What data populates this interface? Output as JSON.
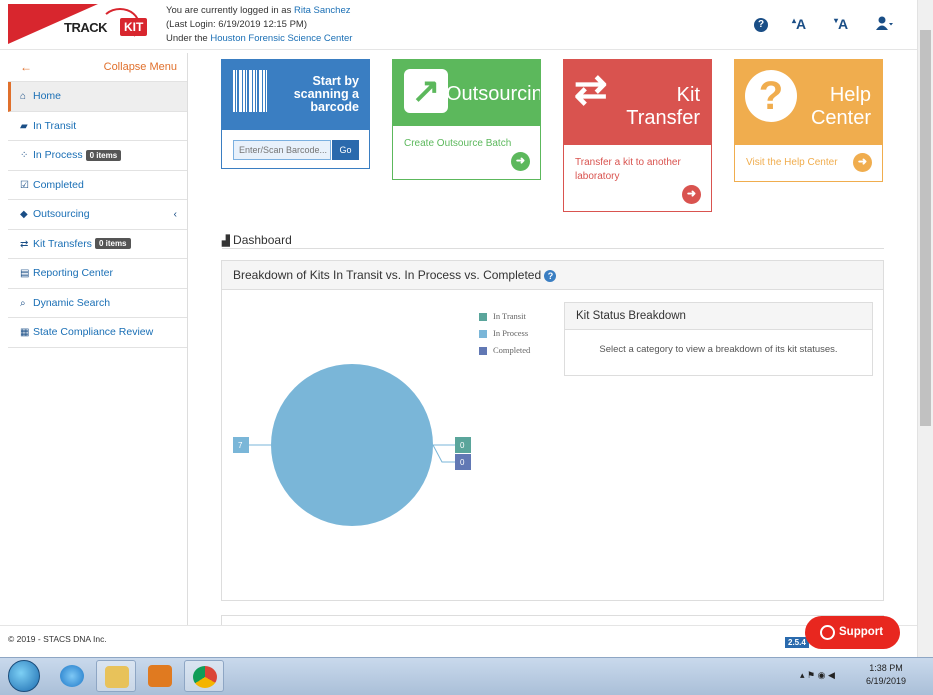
{
  "header": {
    "logo_track": "TRACK",
    "logo_kit": "KIT",
    "login_prefix": "You are currently logged in as ",
    "user_name": "Rita Sanchez",
    "last_login": "(Last Login: 6/19/2019 12:15 PM)",
    "org_prefix": "Under the ",
    "org_name": "Houston Forensic Science Center",
    "icons": [
      "question-circle-icon",
      "font-increase-icon",
      "font-decrease-icon",
      "user-menu-icon"
    ]
  },
  "sidebar": {
    "collapse_label": "Collapse Menu",
    "items": [
      {
        "label": "Home",
        "icon": "home-icon",
        "active": true
      },
      {
        "label": "In Transit",
        "icon": "truck-icon"
      },
      {
        "label": "In Process",
        "icon": "spinner-icon",
        "badge": "0 items"
      },
      {
        "label": "Completed",
        "icon": "check-square-icon"
      },
      {
        "label": "Outsourcing",
        "icon": "tags-icon",
        "chevron": true
      },
      {
        "label": "Kit Transfers",
        "icon": "exchange-icon",
        "badge": "0 items"
      },
      {
        "label": "Reporting Center",
        "icon": "file-icon"
      },
      {
        "label": "Dynamic Search",
        "icon": "search-icon"
      },
      {
        "label": "State Compliance Review",
        "icon": "calendar-check-icon"
      }
    ]
  },
  "tiles": {
    "scan": {
      "title": "Start by scanning a barcode",
      "placeholder": "Enter/Scan Barcode...",
      "go_label": "Go",
      "color": "#3a7ec2"
    },
    "outsourcing": {
      "title": "Outsourcing",
      "link": "Create Outsource Batch",
      "color": "#5cb85c"
    },
    "kit_transfer": {
      "title_line1": "Kit",
      "title_line2": "Transfer",
      "link": "Transfer a kit to another laboratory",
      "color": "#d9534f"
    },
    "help": {
      "title_line1": "Help",
      "title_line2": "Center",
      "link": "Visit the Help Center",
      "color": "#f0ad4e"
    }
  },
  "dashboard": {
    "title": "Dashboard",
    "panel_title": "Breakdown of Kits In Transit vs. In Process vs. Completed",
    "status_title": "Kit Status Breakdown",
    "status_body": "Select a category to view a breakdown of its kit statuses."
  },
  "chart_data": {
    "type": "pie",
    "categories": [
      "In Transit",
      "In Process",
      "Completed"
    ],
    "values": [
      0,
      7,
      0
    ],
    "colors": [
      "#5aa59b",
      "#7ab6d8",
      "#6178b4"
    ],
    "legend_position": "top-right"
  },
  "footer": {
    "copyright": "© 2019 - STACS DNA Inc.",
    "version": "2.5.4",
    "support_label": "Support"
  },
  "taskbar": {
    "time": "1:38 PM",
    "date": "6/19/2019"
  }
}
